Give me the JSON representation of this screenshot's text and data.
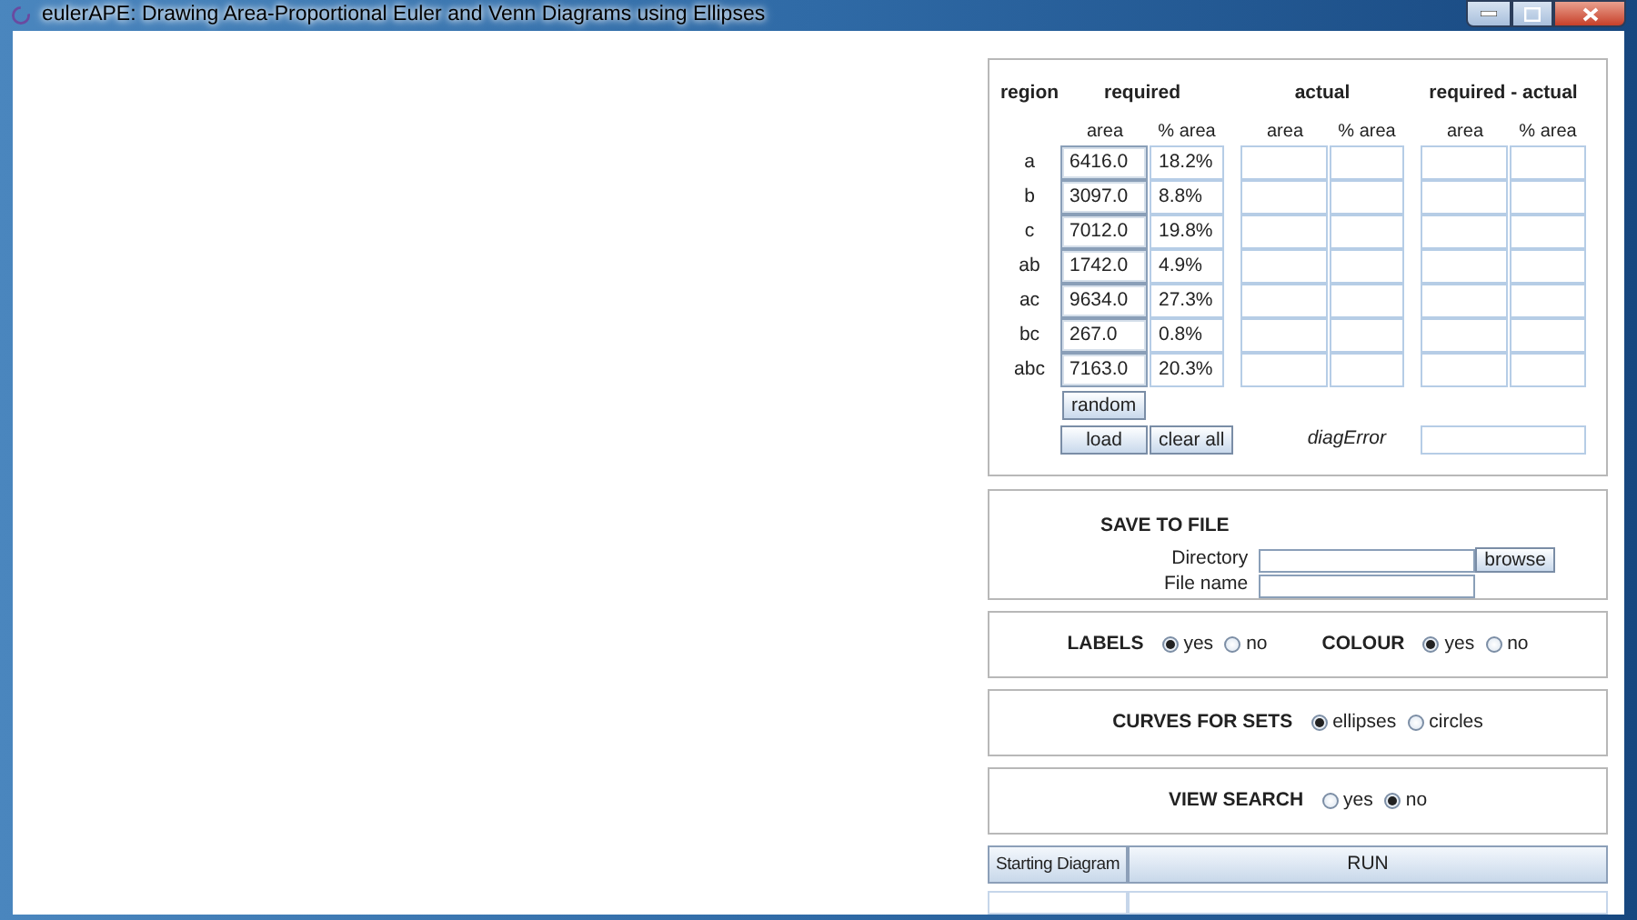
{
  "window": {
    "title": "eulerAPE: Drawing Area-Proportional Euler and Venn Diagrams using Ellipses"
  },
  "region_table": {
    "headers": {
      "region": "region",
      "required": "required",
      "actual": "actual",
      "difference": "required - actual"
    },
    "subheaders": [
      "area",
      "% area",
      "area",
      "% area",
      "area",
      "% area"
    ],
    "rows": [
      {
        "region": "a",
        "area": "6416.0",
        "percent": "18.2%"
      },
      {
        "region": "b",
        "area": "3097.0",
        "percent": "8.8%"
      },
      {
        "region": "c",
        "area": "7012.0",
        "percent": "19.8%"
      },
      {
        "region": "ab",
        "area": "1742.0",
        "percent": "4.9%"
      },
      {
        "region": "ac",
        "area": "9634.0",
        "percent": "27.3%"
      },
      {
        "region": "bc",
        "area": "267.0",
        "percent": "0.8%"
      },
      {
        "region": "abc",
        "area": "7163.0",
        "percent": "20.3%"
      }
    ],
    "random_button": "random",
    "load_button": "load",
    "clear_button": "clear all",
    "diag_error_label": "diagError"
  },
  "save_to_file": {
    "title": "SAVE TO FILE",
    "directory_label": "Directory",
    "browse_button": "browse",
    "file_name_label": "File name"
  },
  "option_panels": [
    {
      "groups": [
        {
          "label": "LABELS",
          "choices": [
            {
              "label": "yes",
              "selected": true
            },
            {
              "label": "no",
              "selected": false
            }
          ]
        },
        {
          "label": "COLOUR",
          "choices": [
            {
              "label": "yes",
              "selected": true
            },
            {
              "label": "no",
              "selected": false
            }
          ]
        }
      ]
    },
    {
      "groups": [
        {
          "label": "CURVES FOR SETS",
          "choices": [
            {
              "label": "ellipses",
              "selected": true
            },
            {
              "label": "circles",
              "selected": false
            }
          ]
        }
      ]
    },
    {
      "groups": [
        {
          "label": "VIEW SEARCH",
          "choices": [
            {
              "label": "yes",
              "selected": false
            },
            {
              "label": "no",
              "selected": true
            }
          ]
        }
      ]
    }
  ],
  "footer": {
    "starting_diagram": "Starting Diagram",
    "run_button": "RUN"
  }
}
